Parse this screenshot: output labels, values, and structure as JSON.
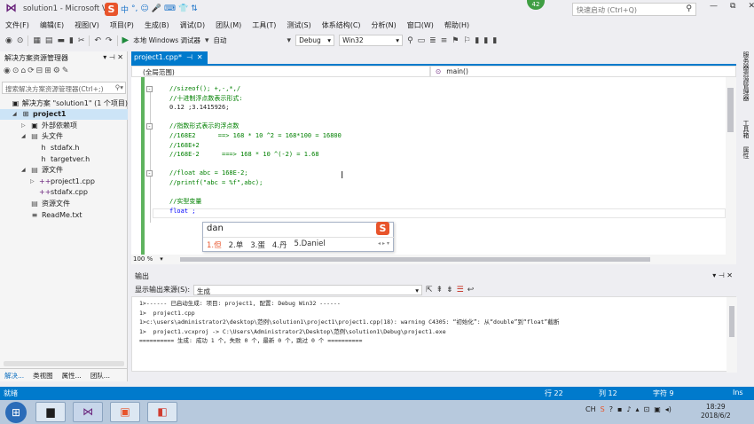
{
  "window": {
    "title": "solution1 - Microsoft Vi",
    "quick_launch_placeholder": "快速启动 (Ctrl+Q)",
    "badge": "42",
    "controls": [
      "—",
      "⧉",
      "✕"
    ]
  },
  "ime_toolbar": {
    "logo": "S",
    "items": [
      "中",
      "°,",
      "☺",
      "🎤",
      "⌨",
      "👕",
      "⇅"
    ]
  },
  "menu": [
    "文件(F)",
    "编辑(E)",
    "视图(V)",
    "项目(P)",
    "生成(B)",
    "调试(D)",
    "团队(M)",
    "工具(T)",
    "测试(S)",
    "体系结构(C)",
    "分析(N)",
    "窗口(W)",
    "帮助(H)"
  ],
  "toolbar": {
    "debugger_label": "本地 Windows 调试器",
    "debugger_mode": "自动",
    "config": "Debug",
    "platform": "Win32"
  },
  "solution_explorer": {
    "title": "解决方案资源管理器",
    "search_placeholder": "搜索解决方案资源管理器(Ctrl+;)",
    "tree": [
      {
        "label": "解决方案 \"solution1\" (1 个项目)",
        "depth": 0,
        "icon": "solution-icon",
        "glyph": "▣",
        "toggle": ""
      },
      {
        "label": "project1",
        "depth": 1,
        "icon": "project-icon",
        "glyph": "⊞",
        "toggle": "◢",
        "bold": true,
        "selected": true
      },
      {
        "label": "外部依赖项",
        "depth": 2,
        "icon": "dependencies-icon",
        "glyph": "▣",
        "toggle": "▷"
      },
      {
        "label": "头文件",
        "depth": 2,
        "icon": "folder-icon",
        "glyph": "▤",
        "toggle": "◢"
      },
      {
        "label": "stdafx.h",
        "depth": 3,
        "icon": "header-file-icon",
        "glyph": "h",
        "toggle": ""
      },
      {
        "label": "targetver.h",
        "depth": 3,
        "icon": "header-file-icon",
        "glyph": "h",
        "toggle": ""
      },
      {
        "label": "源文件",
        "depth": 2,
        "icon": "folder-icon",
        "glyph": "▤",
        "toggle": "◢"
      },
      {
        "label": "project1.cpp",
        "depth": 3,
        "icon": "cpp-file-icon",
        "glyph": "++",
        "toggle": "▷"
      },
      {
        "label": "stdafx.cpp",
        "depth": 3,
        "icon": "cpp-file-icon",
        "glyph": "++",
        "toggle": ""
      },
      {
        "label": "资源文件",
        "depth": 2,
        "icon": "folder-icon",
        "glyph": "▤",
        "toggle": ""
      },
      {
        "label": "ReadMe.txt",
        "depth": 2,
        "icon": "text-file-icon",
        "glyph": "≡",
        "toggle": ""
      }
    ],
    "tabs": [
      "解决...",
      "类视图",
      "属性...",
      "团队..."
    ]
  },
  "editor": {
    "tab_label": "project1.cpp*",
    "scope": "(全局范围)",
    "function": "main()",
    "zoom": "100 %",
    "lines": [
      {
        "text": "//sizeof(); +,-,*,/",
        "cls": "cm"
      },
      {
        "text": "//十进制浮点数表示形式:",
        "cls": "cm"
      },
      {
        "text": "0.12 ;3.1415926;",
        "cls": "num"
      },
      {
        "text": "",
        "cls": "num"
      },
      {
        "text": "//指数形式表示的浮点数",
        "cls": "cm"
      },
      {
        "text": "//168E2      ==> 168 * 10 ^2 = 168*100 = 16800",
        "cls": "cm"
      },
      {
        "text": "//168E+2",
        "cls": "cm"
      },
      {
        "text": "//168E-2      ===> 168 * 10 ^(-2) = 1.68",
        "cls": "cm"
      },
      {
        "text": "",
        "cls": "num"
      },
      {
        "text": "//float abc = 168E-2;",
        "cls": "cm"
      },
      {
        "text": "//printf(\"abc = %f\",abc);",
        "cls": "cm"
      },
      {
        "text": "",
        "cls": "num"
      },
      {
        "text": "//实型变量",
        "cls": "cm"
      },
      {
        "text": "float ;",
        "cls": "kw"
      }
    ]
  },
  "ime_popup": {
    "input": "dan",
    "candidates": [
      "1.但",
      "2.单",
      "3.蛋",
      "4.丹",
      "5.Daniel"
    ]
  },
  "right_rail": [
    "服务器资源管理器",
    "工具箱",
    "属性"
  ],
  "output": {
    "title": "输出",
    "source_label": "显示输出来源(S):",
    "source_value": "生成",
    "lines": [
      "1>------ 已启动生成: 项目: project1, 配置: Debug Win32 ------",
      "1>  project1.cpp",
      "1>c:\\users\\administrator2\\desktop\\范例\\solution1\\project1\\project1.cpp(18): warning C4305: “初始化”: 从“double”到“float”截断",
      "1>  project1.vcxproj -> C:\\Users\\Administrator2\\Desktop\\范例\\solution1\\Debug\\project1.exe",
      "========== 生成: 成功 1 个，失败 0 个，最新 0 个，跳过 0 个 =========="
    ]
  },
  "status": {
    "ready": "就绪",
    "line": "行 22",
    "col": "列 12",
    "char": "字符 9",
    "mode": "Ins"
  },
  "taskbar": {
    "tray": [
      "CH",
      "S",
      "?",
      "▪",
      "♪",
      "▴",
      "⊡",
      "▣",
      "◂)"
    ],
    "time": "18:29",
    "date": "2018/6/2"
  }
}
